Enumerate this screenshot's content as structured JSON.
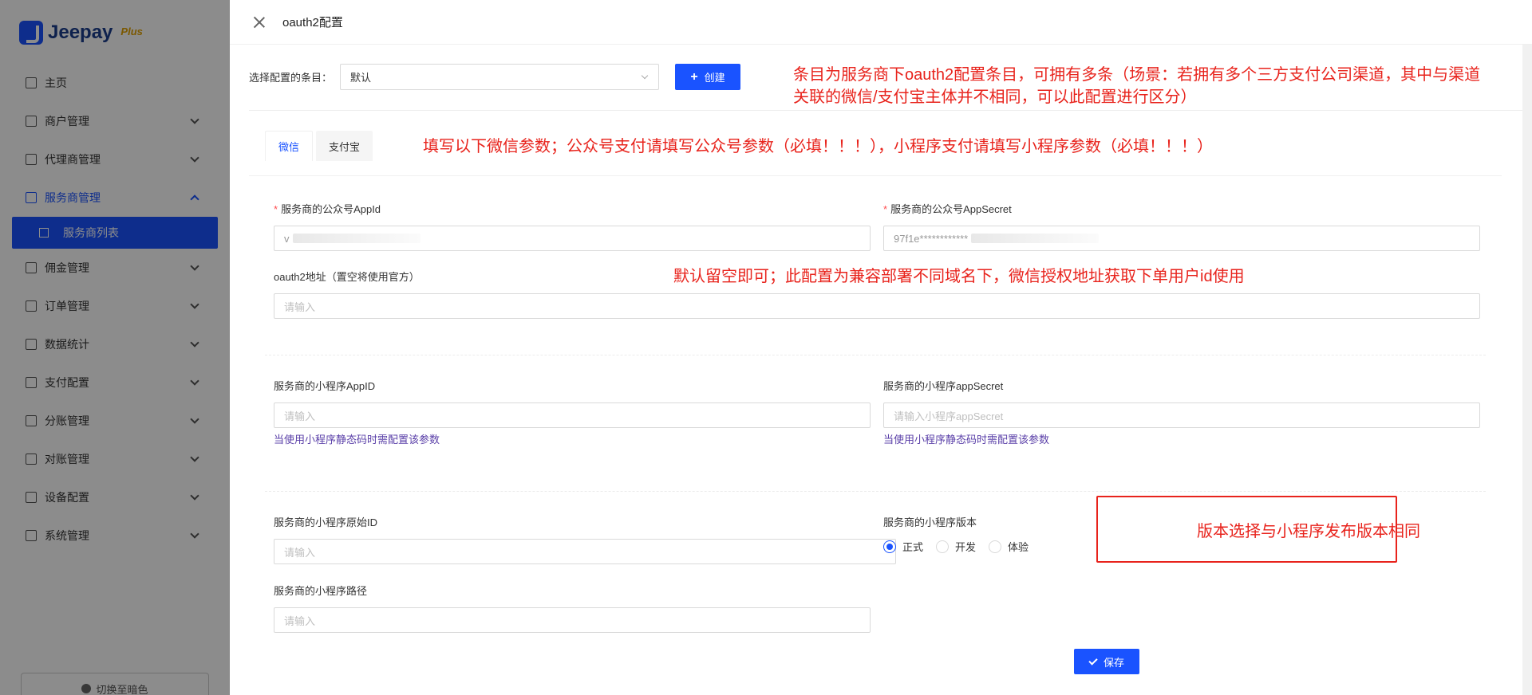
{
  "sidebar": {
    "logo_text": "Jeepay",
    "logo_plus": "Plus",
    "menu": [
      {
        "label": "主页",
        "has_chevron": false
      },
      {
        "label": "商户管理",
        "has_chevron": true
      },
      {
        "label": "代理商管理",
        "has_chevron": true
      },
      {
        "label": "服务商管理",
        "has_chevron": true,
        "expanded": true
      },
      {
        "label": "佣金管理",
        "has_chevron": true
      },
      {
        "label": "订单管理",
        "has_chevron": true
      },
      {
        "label": "数据统计",
        "has_chevron": true
      },
      {
        "label": "支付配置",
        "has_chevron": true
      },
      {
        "label": "分账管理",
        "has_chevron": true
      },
      {
        "label": "对账管理",
        "has_chevron": true
      },
      {
        "label": "设备配置",
        "has_chevron": true
      },
      {
        "label": "系统管理",
        "has_chevron": true
      }
    ],
    "submenu_active": "服务商列表",
    "theme_toggle": "切换至暗色"
  },
  "drawer": {
    "title": "oauth2配置",
    "select_label": "选择配置的条目：",
    "select_value": "默认",
    "create_label": "创建",
    "tabs": [
      {
        "label": "微信",
        "active": true
      },
      {
        "label": "支付宝",
        "active": false
      }
    ],
    "fields": {
      "mp_appid": {
        "label": "服务商的公众号AppId",
        "value": "v"
      },
      "mp_secret": {
        "label": "服务商的公众号AppSecret",
        "value": "97f1e************"
      },
      "oauth2_url": {
        "label": "oauth2地址（置空将使用官方）",
        "placeholder": "请输入"
      },
      "mini_appid": {
        "label": "服务商的小程序AppID",
        "placeholder": "请输入",
        "hint": "当使用小程序静态码时需配置该参数"
      },
      "mini_secret": {
        "label": "服务商的小程序appSecret",
        "placeholder": "请输入小程序appSecret",
        "hint": "当使用小程序静态码时需配置该参数"
      },
      "mini_origin_id": {
        "label": "服务商的小程序原始ID",
        "placeholder": "请输入"
      },
      "mini_version": {
        "label": "服务商的小程序版本",
        "options": [
          "正式",
          "开发",
          "体验"
        ],
        "selected": "正式"
      },
      "mini_path": {
        "label": "服务商的小程序路径",
        "placeholder": "请输入"
      }
    },
    "save_label": "保存"
  },
  "annotations": {
    "note1_line1": "条目为服务商下oauth2配置条目，可拥有多条（场景：若拥有多个三方支付公司渠道，其中与渠道",
    "note1_line2": "关联的微信/支付宝主体并不相同，可以此配置进行区分）",
    "note2": "填写以下微信参数；公众号支付请填写公众号参数（必填！！！），小程序支付请填写小程序参数（必填！！！）",
    "note3": "默认留空即可；此配置为兼容部署不同域名下，微信授权地址获取下单用户id使用",
    "note4": "版本选择与小程序发布版本相同"
  },
  "colors": {
    "primary": "#1a53ff",
    "annotation_red": "#e8231c"
  }
}
